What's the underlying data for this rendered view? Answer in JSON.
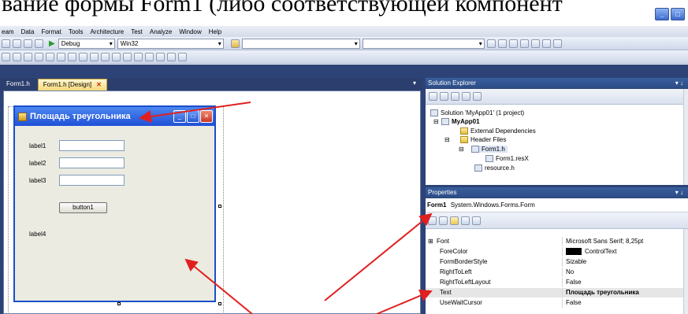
{
  "doc_heading": "вание формы Form1 (либо соответствующей компонент",
  "window_buttons": [
    "_",
    "□"
  ],
  "menu": [
    "eam",
    "Data",
    "Format",
    "Tools",
    "Architecture",
    "Test",
    "Analyze",
    "Window",
    "Help"
  ],
  "toolbar": {
    "config": "Debug",
    "platform": "Win32",
    "combo3": "",
    "combo4": ""
  },
  "tabs": {
    "tab1": "Form1.h",
    "tab2": "Form1.h [Design]",
    "close": "✕",
    "dropdown": "▾"
  },
  "form": {
    "title": "Площадь треугольника",
    "labels": [
      "label1",
      "label2",
      "label3",
      "label4"
    ],
    "button": "button1",
    "buttons": [
      "_",
      "□",
      "✕"
    ]
  },
  "solution_explorer": {
    "title": "Solution Explorer",
    "pin": "▾ ↓",
    "items": [
      "Solution 'MyApp01' (1 project)",
      "MyApp01",
      "External Dependencies",
      "Header Files",
      "Form1.h",
      "Form1.resX",
      "resource.h"
    ],
    "toggles": [
      "⊟",
      "⊟",
      "⊟"
    ]
  },
  "properties": {
    "title": "Properties",
    "pin": "▾ ↓",
    "object_name": "Form1",
    "object_type": "System.Windows.Forms.Form",
    "rows": [
      {
        "name": "Font",
        "value": "Microsoft Sans Serif; 8,25pt",
        "expander": "⊞"
      },
      {
        "name": "ForeColor",
        "value": "ControlText"
      },
      {
        "name": "FormBorderStyle",
        "value": "Sizable"
      },
      {
        "name": "RightToLeft",
        "value": "No"
      },
      {
        "name": "RightToLeftLayout",
        "value": "False"
      },
      {
        "name": "Text",
        "value": "Площадь треугольника"
      },
      {
        "name": "UseWaitCursor",
        "value": "False"
      }
    ]
  },
  "colors": {
    "accent_red": "#e02020",
    "title_blue": "#1f50d8",
    "ide_dark": "#2d4377"
  }
}
